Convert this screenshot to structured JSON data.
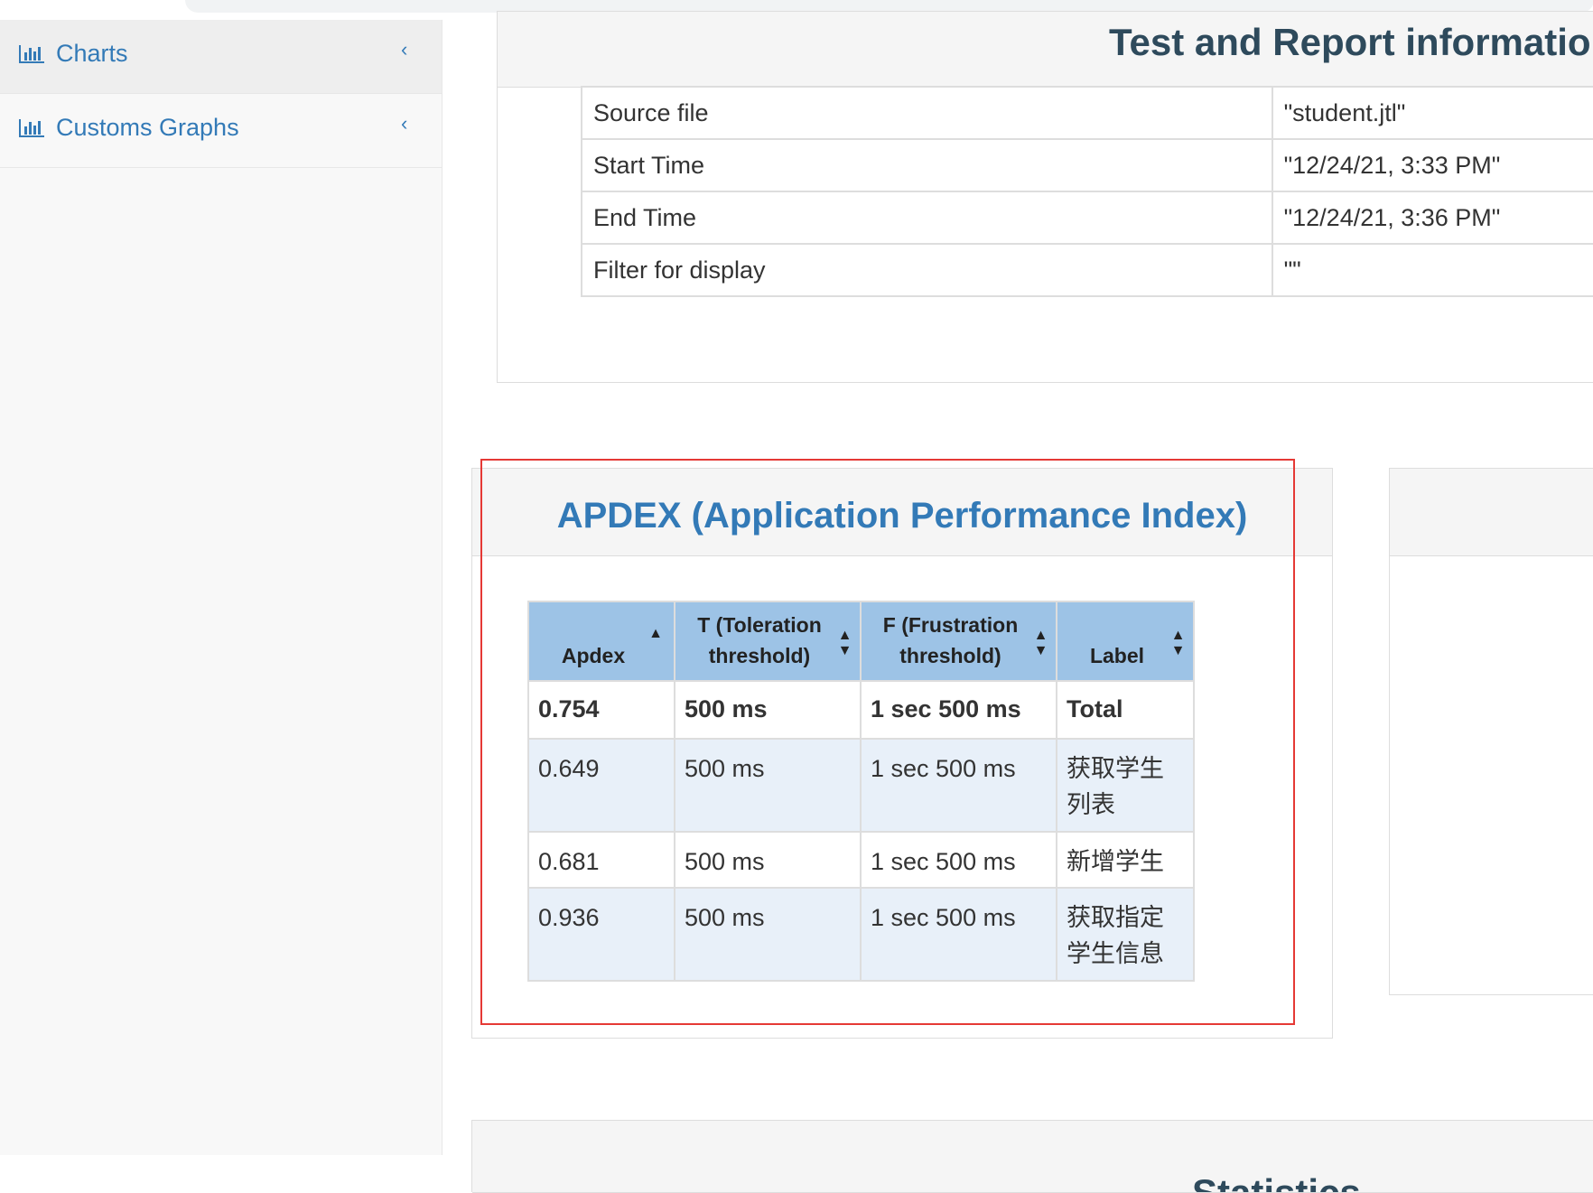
{
  "sidebar": {
    "items": [
      {
        "label": "Charts",
        "icon": "bar-chart-icon",
        "chevron": "‹"
      },
      {
        "label": "Customs Graphs",
        "icon": "bar-chart-icon",
        "chevron": "‹"
      }
    ]
  },
  "test_report": {
    "title": "Test and Report information",
    "rows": [
      {
        "key": "Source file",
        "value": "\"student.jtl\""
      },
      {
        "key": "Start Time",
        "value": "\"12/24/21, 3:33 PM\""
      },
      {
        "key": "End Time",
        "value": "\"12/24/21, 3:36 PM\""
      },
      {
        "key": "Filter for display",
        "value": "\"\""
      }
    ]
  },
  "apdex": {
    "title": "APDEX (Application Performance Index)",
    "headers": [
      {
        "line1": "Apdex",
        "line2": "",
        "sort": "▲"
      },
      {
        "line1": "T (Toleration",
        "line2": "threshold)",
        "sort": "▲▼"
      },
      {
        "line1": "F (Frustration",
        "line2": "threshold)",
        "sort": "▲▼"
      },
      {
        "line1": "Label",
        "line2": "",
        "sort": "▲▼"
      }
    ],
    "total": {
      "apdex": "0.754",
      "t": "500 ms",
      "f": "1 sec 500 ms",
      "label": "Total"
    },
    "rows": [
      {
        "apdex": "0.649",
        "t": "500 ms",
        "f": "1 sec 500 ms",
        "label": "获取学生列表"
      },
      {
        "apdex": "0.681",
        "t": "500 ms",
        "f": "1 sec 500 ms",
        "label": "新增学生"
      },
      {
        "apdex": "0.936",
        "t": "500 ms",
        "f": "1 sec 500 ms",
        "label": "获取指定学生信息"
      }
    ]
  },
  "bottom_panel": {
    "title": "Statistics"
  },
  "colors": {
    "link": "#337ab7",
    "header_bg": "#9dc3e6",
    "alt_row": "#e8f0f9",
    "highlight": "#e53935"
  }
}
